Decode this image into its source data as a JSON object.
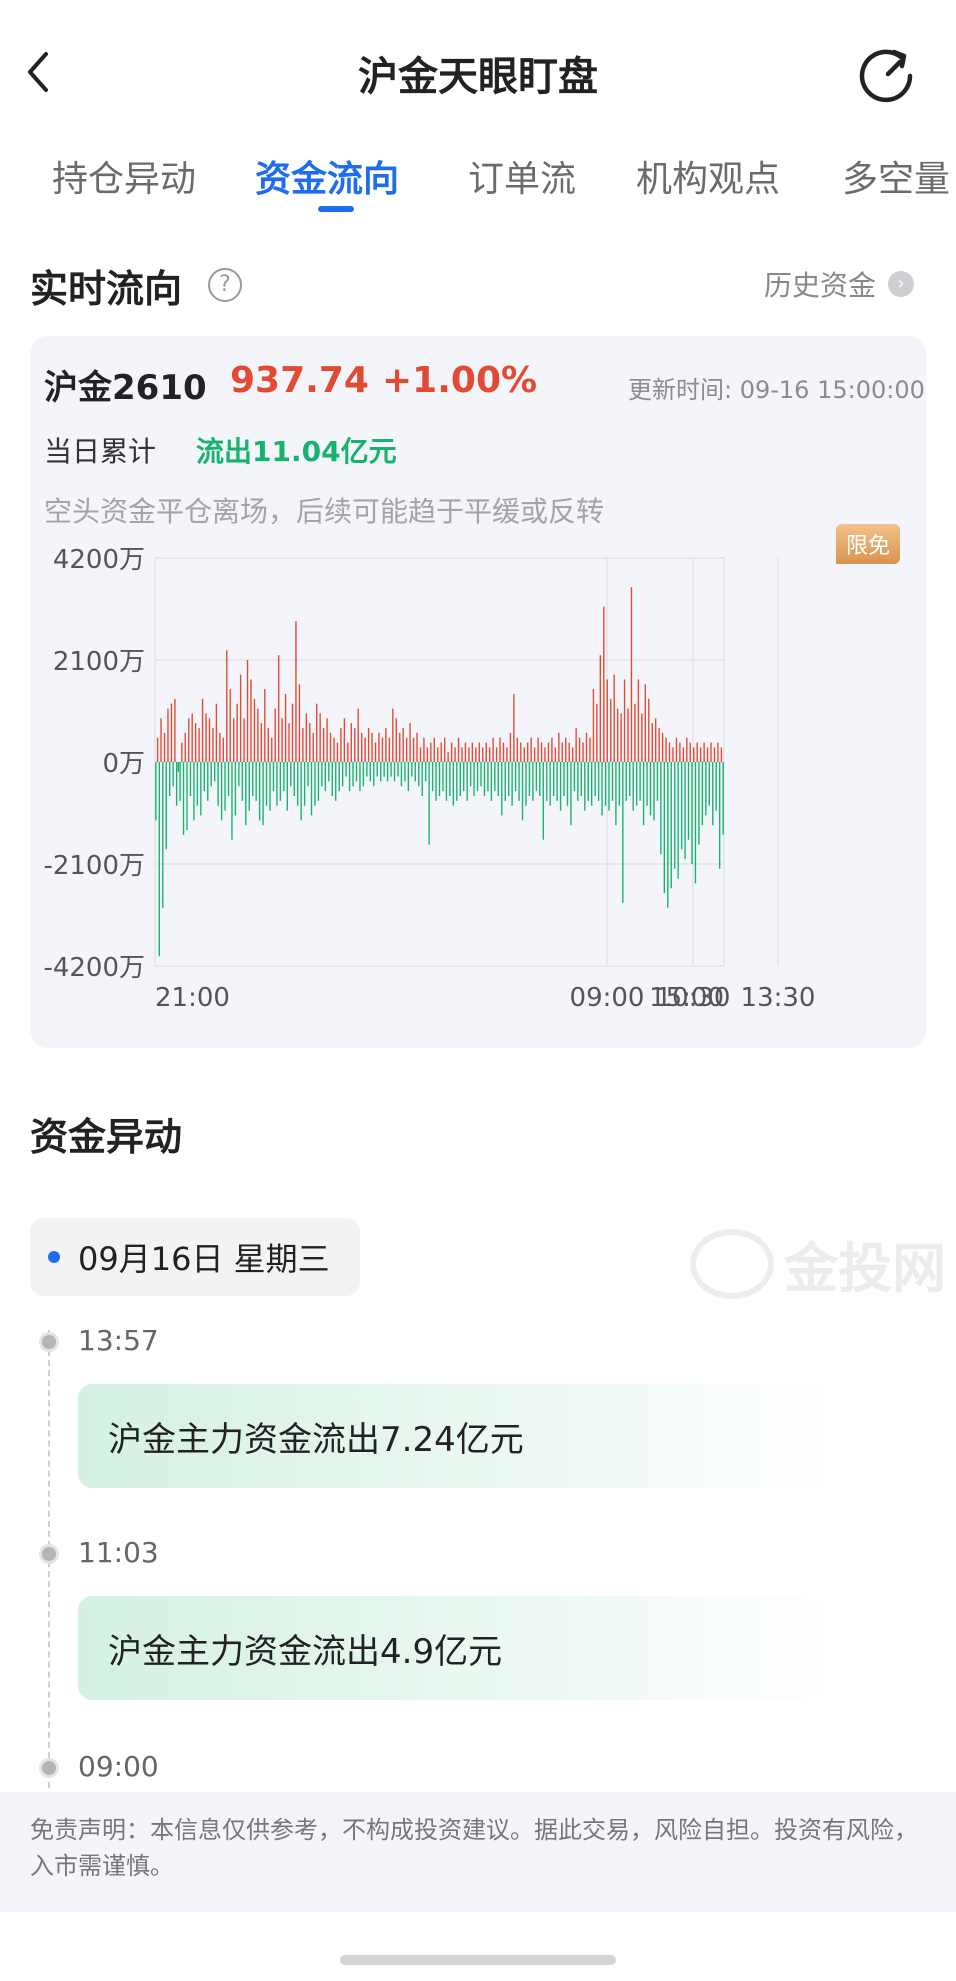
{
  "header": {
    "title": "沪金天眼盯盘",
    "back_icon": "chevron-left-icon",
    "refresh_icon": "refresh-icon"
  },
  "tabs": [
    {
      "label": "持仓异动",
      "active": false
    },
    {
      "label": "资金流向",
      "active": true
    },
    {
      "label": "订单流",
      "active": false
    },
    {
      "label": "机构观点",
      "active": false
    },
    {
      "label": "多空量",
      "active": false
    }
  ],
  "realtime": {
    "title": "实时流向",
    "help_icon": "question-icon",
    "history_label": "历史资金",
    "contract": "沪金2610",
    "price": "937.74",
    "change": "+1.00%",
    "updated": "更新时间: 09-16 15:00:00",
    "cumulative_label": "当日累计",
    "cumulative_value": "流出11.04亿元",
    "note": "空头资金平仓离场，后续可能趋于平缓或反转",
    "badge": "限免",
    "colors": {
      "inflow": "#e24a33",
      "outflow": "#16b36e",
      "accent": "#1f6cf0"
    }
  },
  "chart_data": {
    "type": "bar",
    "y_tick_labels": [
      "4200万",
      "2100万",
      "0万",
      "-2100万",
      "-4200万"
    ],
    "x_tick_labels": [
      "21:00",
      "09:00",
      "10:30",
      "13:30",
      "15:00"
    ],
    "ylim": [
      -4200,
      4200
    ],
    "y_unit": "万",
    "grid": true,
    "series_note": "net capital flow per minute, positive = inflow (red), negative = outflow (green)",
    "values": [
      -1200,
      500,
      -4000,
      900,
      -3000,
      600,
      -1800,
      1100,
      -700,
      1200,
      -500,
      1300,
      -900,
      -200,
      -800,
      400,
      -1500,
      600,
      -1400,
      900,
      -700,
      1000,
      -1200,
      800,
      -900,
      700,
      -1100,
      1300,
      -600,
      1000,
      -800,
      900,
      -500,
      700,
      -400,
      1200,
      -900,
      600,
      -1200,
      500,
      -1000,
      2300,
      -700,
      1500,
      -1600,
      900,
      -1100,
      1200,
      -500,
      1800,
      -800,
      900,
      -1300,
      2100,
      -1000,
      1700,
      -700,
      1300,
      -800,
      1100,
      -1200,
      800,
      -1300,
      1500,
      -900,
      700,
      -1000,
      500,
      -600,
      1100,
      -900,
      2200,
      -800,
      900,
      -600,
      1400,
      -1000,
      800,
      -500,
      1200,
      -700,
      2900,
      -900,
      1600,
      -1200,
      700,
      -900,
      1000,
      -500,
      800,
      -1100,
      600,
      -900,
      1200,
      -800,
      1000,
      -500,
      700,
      -600,
      900,
      -400,
      600,
      -700,
      500,
      -800,
      400,
      -600,
      700,
      -500,
      900,
      -300,
      400,
      -600,
      800,
      -500,
      700,
      -400,
      1100,
      -600,
      600,
      -500,
      500,
      -300,
      700,
      -400,
      600,
      -500,
      400,
      -300,
      600,
      -400,
      500,
      -300,
      700,
      -400,
      500,
      -300,
      1100,
      -400,
      900,
      -300,
      600,
      -500,
      700,
      -400,
      500,
      -600,
      800,
      -300,
      500,
      -400,
      600,
      -500,
      300,
      -700,
      500,
      -400,
      300,
      -1700,
      400,
      -600,
      500,
      -800,
      300,
      -700,
      400,
      -600,
      500,
      -800,
      200,
      -700,
      400,
      -900,
      300,
      -800,
      500,
      -700,
      300,
      -600,
      400,
      -800,
      300,
      -500,
      400,
      -700,
      300,
      -600,
      400,
      -500,
      300,
      -700,
      400,
      -600,
      300,
      -800,
      500,
      -600,
      300,
      -700,
      500,
      -1100,
      400,
      -800,
      300,
      -700,
      600,
      -900,
      1400,
      -600,
      500,
      -800,
      400,
      -1200,
      300,
      -900,
      400,
      -700,
      500,
      -800,
      300,
      -600,
      500,
      -700,
      400,
      -1600,
      300,
      -800,
      400,
      -900,
      500,
      -700,
      300,
      -800,
      600,
      -1000,
      400,
      -700,
      500,
      -900,
      400,
      -1300,
      300,
      -600,
      700,
      -800,
      500,
      -700,
      400,
      -1000,
      600,
      -800,
      500,
      -900,
      1500,
      -700,
      1200,
      -800,
      2200,
      -1100,
      3200,
      -900,
      1700,
      -1000,
      1300,
      -800,
      1800,
      -1300,
      1100,
      -900,
      1000,
      -2900,
      1700,
      -800,
      1100,
      -700,
      3600,
      -1000,
      1200,
      -900,
      1700,
      -800,
      1000,
      -1300,
      1600,
      -900,
      1300,
      -1100,
      800,
      -1200,
      900,
      -800,
      700,
      -1900,
      600,
      -2700,
      500,
      -3000,
      400,
      -2600,
      300,
      -2200,
      500,
      -2400,
      400,
      -1800,
      300,
      -2000,
      500,
      -1600,
      400,
      -2100,
      300,
      -2500,
      400,
      -1700,
      300,
      -1300,
      400,
      -1100,
      300,
      -900,
      400,
      -1300,
      300,
      -1000,
      400,
      -2200,
      300,
      -1500
    ]
  },
  "events": {
    "title": "资金异动",
    "date": "09月16日 星期三",
    "watermark": "金投网",
    "items": [
      {
        "time": "13:57",
        "text": "沪金主力资金流出7.24亿元"
      },
      {
        "time": "11:03",
        "text": "沪金主力资金流出4.9亿元"
      },
      {
        "time": "09:00",
        "text": ""
      }
    ]
  },
  "disclaimer": "免责声明：本信息仅供参考，不构成投资建议。据此交易，风险自担。投资有风险，入市需谨慎。"
}
